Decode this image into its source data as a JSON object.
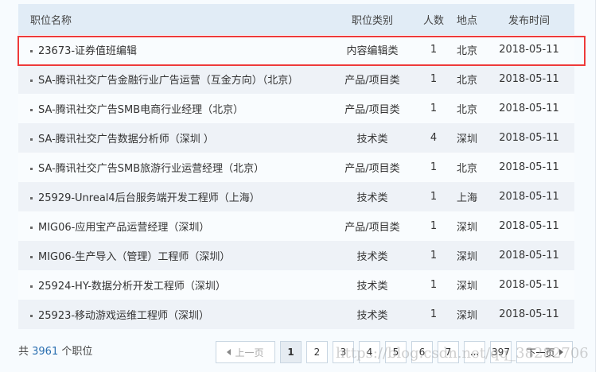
{
  "header": {
    "name": "职位名称",
    "category": "职位类别",
    "count": "人数",
    "location": "地点",
    "date": "发布时间"
  },
  "rows": [
    {
      "name": "23673-证券值班编辑",
      "category": "内容编辑类",
      "count": "1",
      "location": "北京",
      "date": "2018-05-11"
    },
    {
      "name": "SA-腾讯社交广告金融行业广告运营（互金方向）（北京）",
      "category": "产品/项目类",
      "count": "1",
      "location": "北京",
      "date": "2018-05-11"
    },
    {
      "name": "SA-腾讯社交广告SMB电商行业经理（北京）",
      "category": "产品/项目类",
      "count": "1",
      "location": "北京",
      "date": "2018-05-11"
    },
    {
      "name": "SA-腾讯社交广告数据分析师（深圳 ）",
      "category": "技术类",
      "count": "4",
      "location": "深圳",
      "date": "2018-05-11"
    },
    {
      "name": "SA-腾讯社交广告SMB旅游行业运营经理（北京）",
      "category": "产品/项目类",
      "count": "1",
      "location": "北京",
      "date": "2018-05-11"
    },
    {
      "name": "25929-Unreal4后台服务端开发工程师（上海）",
      "category": "技术类",
      "count": "1",
      "location": "上海",
      "date": "2018-05-11"
    },
    {
      "name": "MIG06-应用宝产品运营经理（深圳）",
      "category": "产品/项目类",
      "count": "1",
      "location": "深圳",
      "date": "2018-05-11"
    },
    {
      "name": "MIG06-生产导入（管理）工程师（深圳）",
      "category": "技术类",
      "count": "1",
      "location": "深圳",
      "date": "2018-05-11"
    },
    {
      "name": "25924-HY-数据分析开发工程师（深圳）",
      "category": "技术类",
      "count": "1",
      "location": "深圳",
      "date": "2018-05-11"
    },
    {
      "name": "25923-移动游戏运维工程师（深圳）",
      "category": "技术类",
      "count": "1",
      "location": "深圳",
      "date": "2018-05-11"
    }
  ],
  "footer": {
    "prefix": "共 ",
    "total": "3961",
    "suffix": " 个职位"
  },
  "pager": {
    "prev": "上一页",
    "pages": [
      "1",
      "2",
      "3",
      "4",
      "5",
      "6",
      "7",
      "...",
      "397"
    ],
    "current": "1",
    "next": "下一页"
  },
  "watermark": "https://blog.csdn.net/qq_38282706"
}
